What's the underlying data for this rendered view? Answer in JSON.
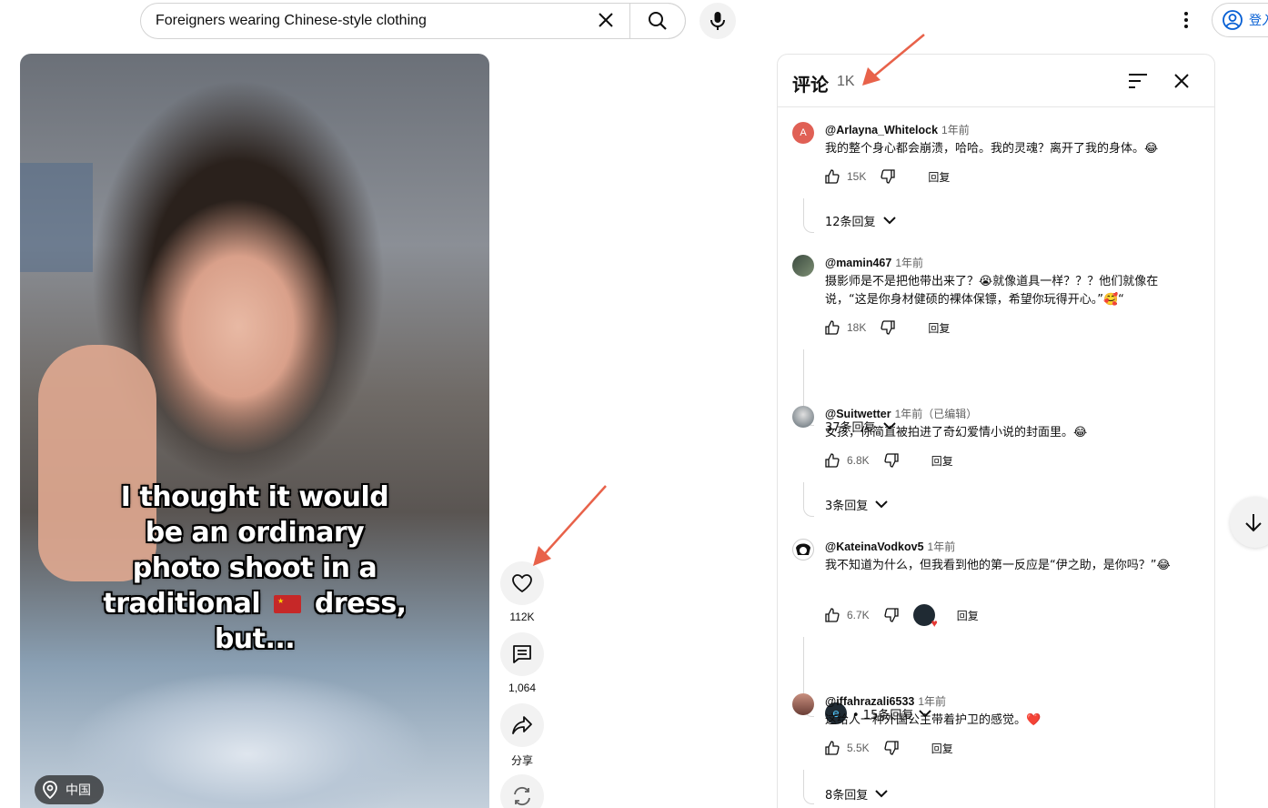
{
  "search": {
    "query": "Foreigners wearing Chinese-style clothing",
    "icons": {
      "clear": "close-icon",
      "search": "search-icon",
      "mic": "mic-icon"
    }
  },
  "header": {
    "more_icon": "more-vert-icon",
    "signin_label": "登入"
  },
  "video": {
    "caption": "I thought it would\nbe an ordinary\nphoto shoot in a\ntraditional      dress,\nbut...",
    "flag": "china-flag",
    "location": "中国"
  },
  "actions": {
    "like_count": "112K",
    "comment_count": "1,064",
    "share_label": "分享"
  },
  "comments_panel": {
    "title": "评论",
    "count": "1K",
    "reply_label": "回复",
    "comments": [
      {
        "author": "@Arlayna_Whitelock",
        "time": "1年前",
        "text": "我的整个身心都会崩溃，哈哈。我的灵魂？离开了我的身体。😂",
        "likes": "15K",
        "replies": "12条回复",
        "avatar_letter": "A",
        "avatar_color": "#e06055"
      },
      {
        "author": "@mamin467",
        "time": "1年前",
        "text": "摄影师是不是把他带出来了？😭就像道具一样？？？他们就像在说，“这是你身材健硕的裸体保镖，希望你玩得开心。”🥰“",
        "likes": "18K",
        "replies": "37条回复"
      },
      {
        "author": "@Suitwetter",
        "time": "1年前（已编辑）",
        "text": "女孩，你简直被拍进了奇幻爱情小说的封面里。😂",
        "likes": "6.8K",
        "replies": "3条回复"
      },
      {
        "author": "@KateinaVodkov5",
        "time": "1年前",
        "text": "我不知道为什么，但我看到他的第一反应是“伊之助，是你吗？”😂",
        "likes": "6.7K",
        "replies": "• 15条回复"
      },
      {
        "author": "@iffahrazali6533",
        "time": "1年前",
        "text": "这给人一种外国公主带着护卫的感觉。❤️",
        "likes": "5.5K",
        "replies": "8条回复"
      }
    ]
  },
  "colors": {
    "annotation_arrow": "#e8624a",
    "link_blue": "#065fd4"
  }
}
